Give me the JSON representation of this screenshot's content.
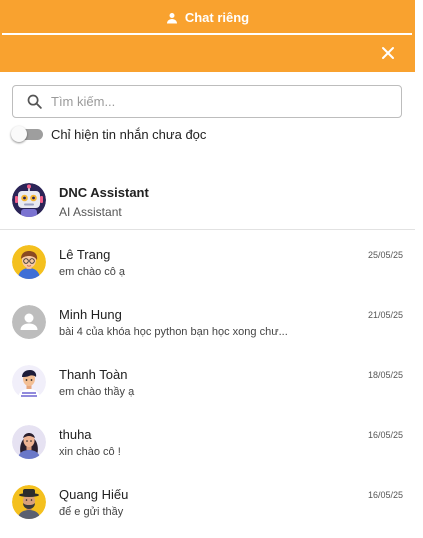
{
  "header": {
    "tab_label": "Chat riêng",
    "accent_color": "#f9a22f"
  },
  "search": {
    "placeholder": "Tìm kiếm...",
    "value": ""
  },
  "filter": {
    "unread_only_label": "Chỉ hiện tin nhắn chưa đọc",
    "enabled": false
  },
  "assistant": {
    "name": "DNC Assistant",
    "subtitle": "AI Assistant"
  },
  "conversations": [
    {
      "name": "Lê Trang",
      "last_message": "em chào cô ạ",
      "date": "25/05/25"
    },
    {
      "name": "Minh Hung",
      "last_message": "bài 4 của khóa học python bạn học xong chư...",
      "date": "21/05/25"
    },
    {
      "name": "Thanh Toàn",
      "last_message": "em chào thầy ạ",
      "date": "18/05/25"
    },
    {
      "name": "thuha",
      "last_message": "xin chào cô !",
      "date": "16/05/25"
    },
    {
      "name": "Quang Hiếu",
      "last_message": "để e gửi thầy",
      "date": "16/05/25"
    }
  ]
}
